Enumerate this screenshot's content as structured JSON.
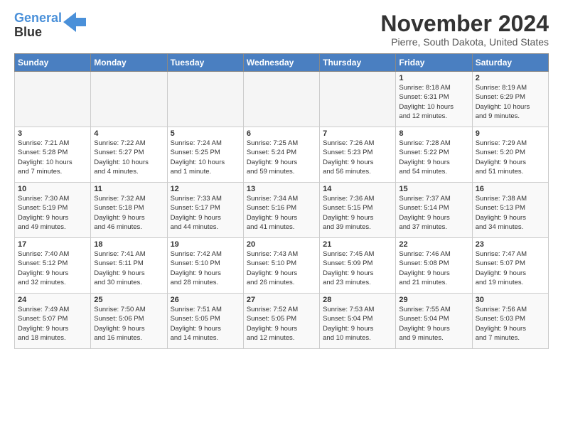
{
  "logo": {
    "line1": "General",
    "line2": "Blue"
  },
  "header": {
    "month": "November 2024",
    "location": "Pierre, South Dakota, United States"
  },
  "weekdays": [
    "Sunday",
    "Monday",
    "Tuesday",
    "Wednesday",
    "Thursday",
    "Friday",
    "Saturday"
  ],
  "weeks": [
    [
      {
        "day": "",
        "info": ""
      },
      {
        "day": "",
        "info": ""
      },
      {
        "day": "",
        "info": ""
      },
      {
        "day": "",
        "info": ""
      },
      {
        "day": "",
        "info": ""
      },
      {
        "day": "1",
        "info": "Sunrise: 8:18 AM\nSunset: 6:31 PM\nDaylight: 10 hours\nand 12 minutes."
      },
      {
        "day": "2",
        "info": "Sunrise: 8:19 AM\nSunset: 6:29 PM\nDaylight: 10 hours\nand 9 minutes."
      }
    ],
    [
      {
        "day": "3",
        "info": "Sunrise: 7:21 AM\nSunset: 5:28 PM\nDaylight: 10 hours\nand 7 minutes."
      },
      {
        "day": "4",
        "info": "Sunrise: 7:22 AM\nSunset: 5:27 PM\nDaylight: 10 hours\nand 4 minutes."
      },
      {
        "day": "5",
        "info": "Sunrise: 7:24 AM\nSunset: 5:25 PM\nDaylight: 10 hours\nand 1 minute."
      },
      {
        "day": "6",
        "info": "Sunrise: 7:25 AM\nSunset: 5:24 PM\nDaylight: 9 hours\nand 59 minutes."
      },
      {
        "day": "7",
        "info": "Sunrise: 7:26 AM\nSunset: 5:23 PM\nDaylight: 9 hours\nand 56 minutes."
      },
      {
        "day": "8",
        "info": "Sunrise: 7:28 AM\nSunset: 5:22 PM\nDaylight: 9 hours\nand 54 minutes."
      },
      {
        "day": "9",
        "info": "Sunrise: 7:29 AM\nSunset: 5:20 PM\nDaylight: 9 hours\nand 51 minutes."
      }
    ],
    [
      {
        "day": "10",
        "info": "Sunrise: 7:30 AM\nSunset: 5:19 PM\nDaylight: 9 hours\nand 49 minutes."
      },
      {
        "day": "11",
        "info": "Sunrise: 7:32 AM\nSunset: 5:18 PM\nDaylight: 9 hours\nand 46 minutes."
      },
      {
        "day": "12",
        "info": "Sunrise: 7:33 AM\nSunset: 5:17 PM\nDaylight: 9 hours\nand 44 minutes."
      },
      {
        "day": "13",
        "info": "Sunrise: 7:34 AM\nSunset: 5:16 PM\nDaylight: 9 hours\nand 41 minutes."
      },
      {
        "day": "14",
        "info": "Sunrise: 7:36 AM\nSunset: 5:15 PM\nDaylight: 9 hours\nand 39 minutes."
      },
      {
        "day": "15",
        "info": "Sunrise: 7:37 AM\nSunset: 5:14 PM\nDaylight: 9 hours\nand 37 minutes."
      },
      {
        "day": "16",
        "info": "Sunrise: 7:38 AM\nSunset: 5:13 PM\nDaylight: 9 hours\nand 34 minutes."
      }
    ],
    [
      {
        "day": "17",
        "info": "Sunrise: 7:40 AM\nSunset: 5:12 PM\nDaylight: 9 hours\nand 32 minutes."
      },
      {
        "day": "18",
        "info": "Sunrise: 7:41 AM\nSunset: 5:11 PM\nDaylight: 9 hours\nand 30 minutes."
      },
      {
        "day": "19",
        "info": "Sunrise: 7:42 AM\nSunset: 5:10 PM\nDaylight: 9 hours\nand 28 minutes."
      },
      {
        "day": "20",
        "info": "Sunrise: 7:43 AM\nSunset: 5:10 PM\nDaylight: 9 hours\nand 26 minutes."
      },
      {
        "day": "21",
        "info": "Sunrise: 7:45 AM\nSunset: 5:09 PM\nDaylight: 9 hours\nand 23 minutes."
      },
      {
        "day": "22",
        "info": "Sunrise: 7:46 AM\nSunset: 5:08 PM\nDaylight: 9 hours\nand 21 minutes."
      },
      {
        "day": "23",
        "info": "Sunrise: 7:47 AM\nSunset: 5:07 PM\nDaylight: 9 hours\nand 19 minutes."
      }
    ],
    [
      {
        "day": "24",
        "info": "Sunrise: 7:49 AM\nSunset: 5:07 PM\nDaylight: 9 hours\nand 18 minutes."
      },
      {
        "day": "25",
        "info": "Sunrise: 7:50 AM\nSunset: 5:06 PM\nDaylight: 9 hours\nand 16 minutes."
      },
      {
        "day": "26",
        "info": "Sunrise: 7:51 AM\nSunset: 5:05 PM\nDaylight: 9 hours\nand 14 minutes."
      },
      {
        "day": "27",
        "info": "Sunrise: 7:52 AM\nSunset: 5:05 PM\nDaylight: 9 hours\nand 12 minutes."
      },
      {
        "day": "28",
        "info": "Sunrise: 7:53 AM\nSunset: 5:04 PM\nDaylight: 9 hours\nand 10 minutes."
      },
      {
        "day": "29",
        "info": "Sunrise: 7:55 AM\nSunset: 5:04 PM\nDaylight: 9 hours\nand 9 minutes."
      },
      {
        "day": "30",
        "info": "Sunrise: 7:56 AM\nSunset: 5:03 PM\nDaylight: 9 hours\nand 7 minutes."
      }
    ]
  ]
}
